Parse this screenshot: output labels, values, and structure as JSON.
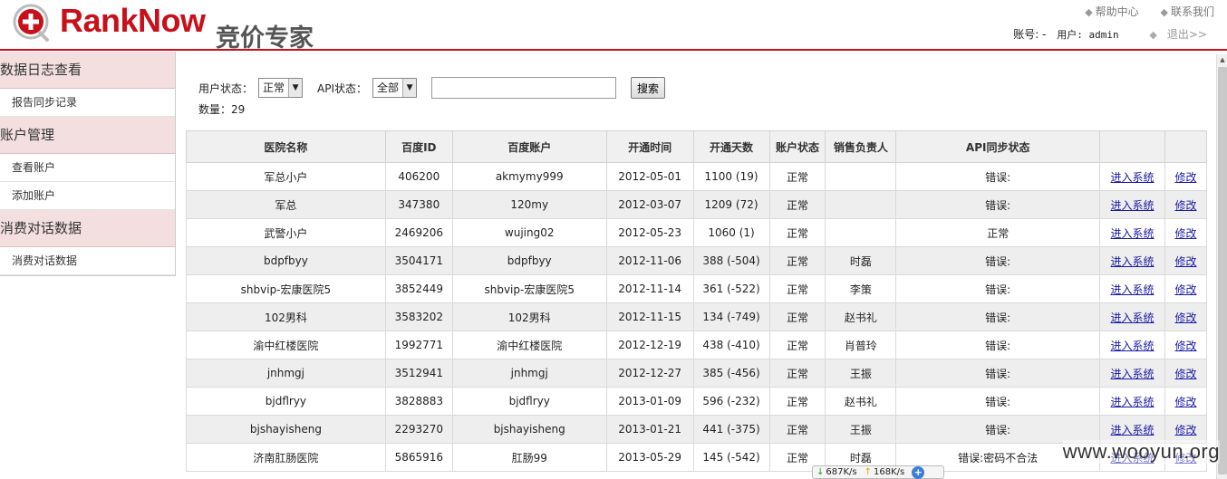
{
  "header": {
    "brand": "RankNow",
    "subtitle": "竞价专家",
    "help_link": "帮助中心",
    "contact_link": "联系我们",
    "account_label": "账号: -",
    "user_label": "用户: admin",
    "logout_link": "退出>>",
    "brand_color": "#c8101a"
  },
  "sidebar": {
    "groups": [
      {
        "label": "数据日志查看",
        "items": [
          "报告同步记录"
        ]
      },
      {
        "label": "账户管理",
        "items": [
          "查看账户",
          "添加账户"
        ]
      },
      {
        "label": "消费对话数据",
        "items": [
          "消费对话数据"
        ]
      }
    ]
  },
  "filters": {
    "user_status_label": "用户状态：",
    "user_status_value": "正常",
    "api_status_label": "API状态：",
    "api_status_value": "全部",
    "search_value": "",
    "search_button": "搜索",
    "count_text": "数量：29"
  },
  "table": {
    "headers": [
      "医院名称",
      "百度ID",
      "百度账户",
      "开通时间",
      "开通天数",
      "账户状态",
      "销售负责人",
      "API同步状态",
      "",
      ""
    ],
    "enter_label": "进入系统",
    "edit_label": "修改",
    "rows": [
      {
        "name": "军总小户",
        "id": "406200",
        "account": "akmymy999",
        "date": "2012-05-01",
        "days": "1100 (19)",
        "days_color": "normal",
        "status": "正常",
        "owner": "",
        "api": "错误:",
        "api_color": "red"
      },
      {
        "name": "军总",
        "id": "347380",
        "account": "120my",
        "date": "2012-03-07",
        "days": "1209 (72)",
        "days_color": "normal",
        "status": "正常",
        "owner": "",
        "api": "错误:",
        "api_color": "red"
      },
      {
        "name": "武警小户",
        "id": "2469206",
        "account": "wujing02",
        "date": "2012-05-23",
        "days": "1060 (1)",
        "days_color": "orange",
        "status": "正常",
        "owner": "",
        "api": "正常",
        "api_color": "normal"
      },
      {
        "name": "bdpfbyy",
        "id": "3504171",
        "account": "bdpfbyy",
        "date": "2012-11-06",
        "days": "388 (-504)",
        "days_color": "red",
        "status": "正常",
        "owner": "时磊",
        "api": "错误:",
        "api_color": "red"
      },
      {
        "name": "shbvip-宏康医院5",
        "id": "3852449",
        "account": "shbvip-宏康医院5",
        "date": "2012-11-14",
        "days": "361 (-522)",
        "days_color": "red",
        "status": "正常",
        "owner": "李策",
        "api": "错误:",
        "api_color": "red"
      },
      {
        "name": "102男科",
        "id": "3583202",
        "account": "102男科",
        "date": "2012-11-15",
        "days": "134 (-749)",
        "days_color": "red",
        "status": "正常",
        "owner": "赵书礼",
        "api": "错误:",
        "api_color": "red"
      },
      {
        "name": "渝中红楼医院",
        "id": "1992771",
        "account": "渝中红楼医院",
        "date": "2012-12-19",
        "days": "438 (-410)",
        "days_color": "red",
        "status": "正常",
        "owner": "肖普玲",
        "api": "错误:",
        "api_color": "red"
      },
      {
        "name": "jnhmgj",
        "id": "3512941",
        "account": "jnhmgj",
        "date": "2012-12-27",
        "days": "385 (-456)",
        "days_color": "red",
        "status": "正常",
        "owner": "王振",
        "api": "错误:",
        "api_color": "red"
      },
      {
        "name": "bjdflryy",
        "id": "3828883",
        "account": "bjdflryy",
        "date": "2013-01-09",
        "days": "596 (-232)",
        "days_color": "red",
        "status": "正常",
        "owner": "赵书礼",
        "api": "错误:",
        "api_color": "red"
      },
      {
        "name": "bjshayisheng",
        "id": "2293270",
        "account": "bjshayisheng",
        "date": "2013-01-21",
        "days": "441 (-375)",
        "days_color": "red",
        "status": "正常",
        "owner": "王振",
        "api": "错误:",
        "api_color": "red"
      },
      {
        "name": "济南肛肠医院",
        "id": "5865916",
        "account": "肛肠99",
        "date": "2013-05-29",
        "days": "145 (-542)",
        "days_color": "red",
        "status": "正常",
        "owner": "时磊",
        "api": "错误:密码不合法",
        "api_color": "red"
      }
    ]
  },
  "overlays": {
    "watermark": "www.wooyun.org",
    "net_down": "687K/s",
    "net_up": "168K/s"
  }
}
